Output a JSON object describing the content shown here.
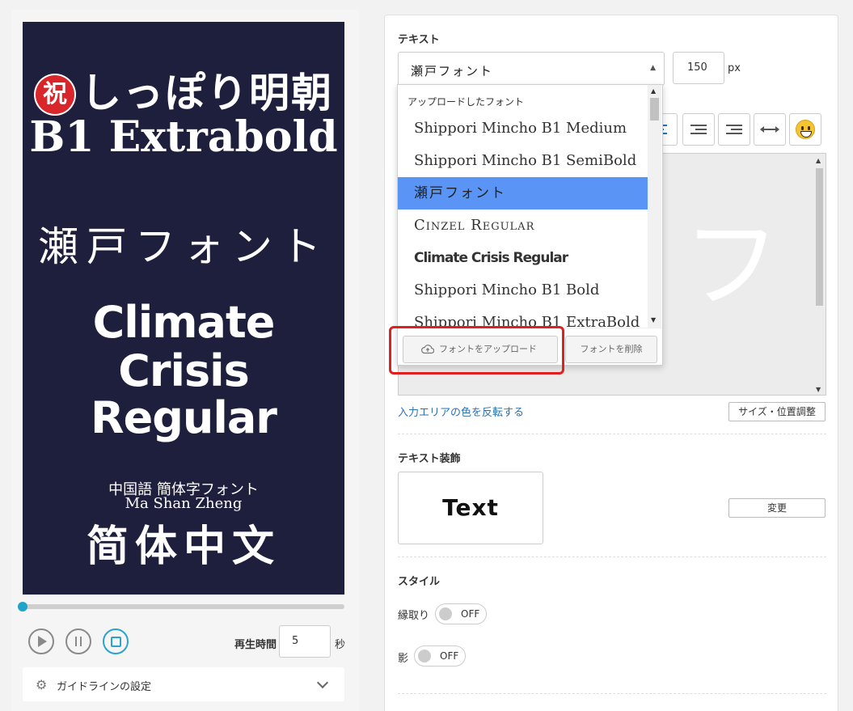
{
  "preview": {
    "badge": "祝",
    "title1": "しっぽり明朝",
    "title2": "B1 Extrabold",
    "seto": "瀬戸フォント",
    "climate1": "Climate",
    "climate2": "Crisis",
    "climate3": "Regular",
    "cn1": "中国語 簡体字フォント",
    "cn2": "Ma Shan Zheng",
    "cn3": "简体中文"
  },
  "playback": {
    "progress_fraction": 0.0,
    "time_label": "再生時間",
    "time_value": "5",
    "time_unit": "秒"
  },
  "guideline": {
    "label": "ガイドラインの設定"
  },
  "text_section": {
    "label": "テキスト",
    "font_value": "瀬戸フォント",
    "size_value": "150",
    "size_unit": "px",
    "invert_link": "入力エリアの色を反転する",
    "size_position_button": "サイズ・位置調整",
    "canvas_glyph": "フ"
  },
  "dropdown": {
    "group_label": "アップロードしたフォント",
    "items": [
      "Shippori Mincho B1 Medium",
      "Shippori Mincho B1 SemiBold",
      "瀬戸フォント",
      "Cinzel Regular",
      "Climate Crisis Regular",
      "Shippori Mincho B1 Bold",
      "Shippori Mincho B1 ExtraBold"
    ],
    "selected_index": 2,
    "upload_button": "フォントをアップロード",
    "delete_button": "フォントを削除"
  },
  "decoration": {
    "label": "テキスト装飾",
    "sample": "Text",
    "change_button": "変更"
  },
  "style": {
    "label": "スタイル",
    "outline_label": "縁取り",
    "outline_state": "OFF",
    "shadow_label": "影",
    "shadow_state": "OFF"
  },
  "colors": {
    "preview_bg": "#1e1f3d",
    "accent": "#1ea3c9",
    "selected_item": "#5a95f5",
    "highlight": "#e02020",
    "link": "#2a72b5"
  }
}
